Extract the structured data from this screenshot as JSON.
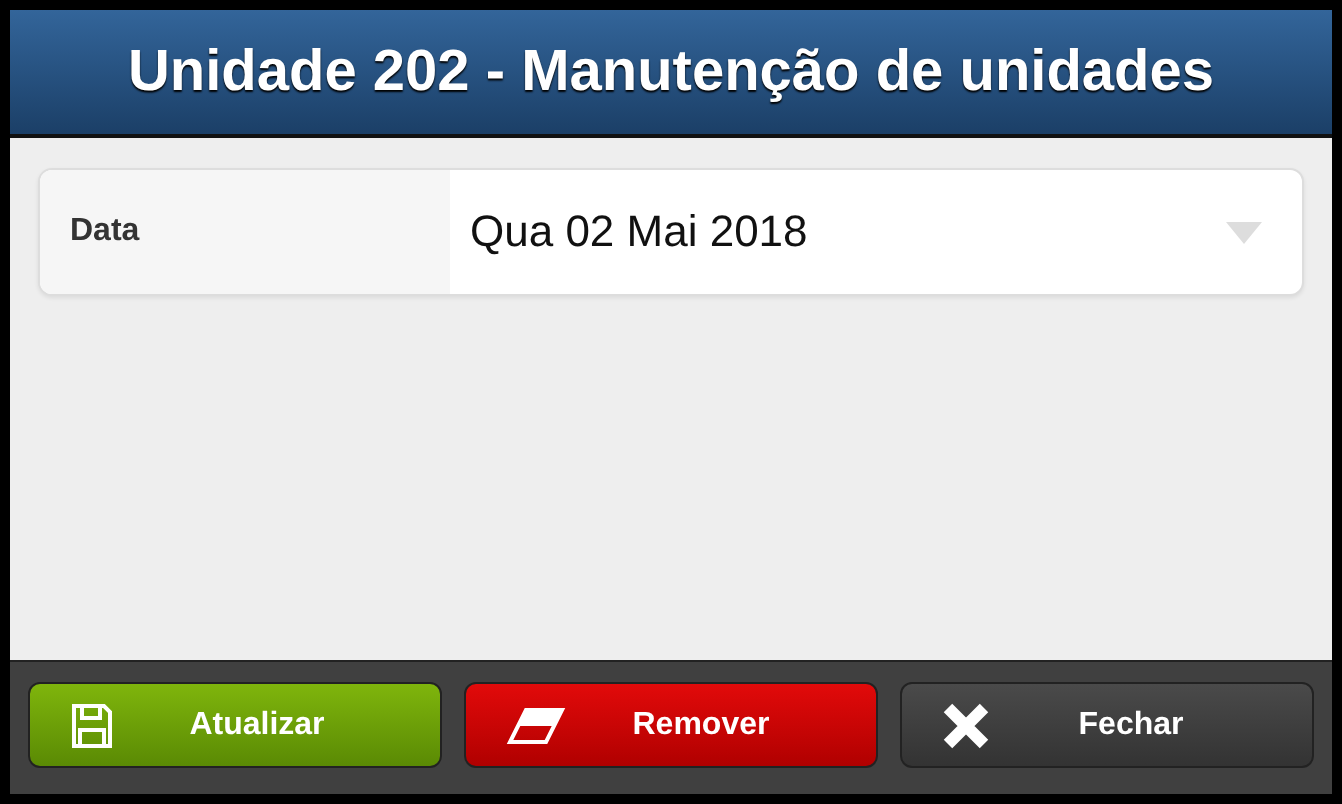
{
  "window": {
    "title": "Unidade 202 - Manutenção de unidades"
  },
  "fields": [
    {
      "label": "Data",
      "value": "Qua 02 Mai 2018",
      "kind": "select"
    }
  ],
  "buttons": [
    {
      "label": "Atualizar",
      "kind": "save"
    },
    {
      "label": "Remover",
      "kind": "remove"
    },
    {
      "label": "Fechar",
      "kind": "close"
    }
  ]
}
